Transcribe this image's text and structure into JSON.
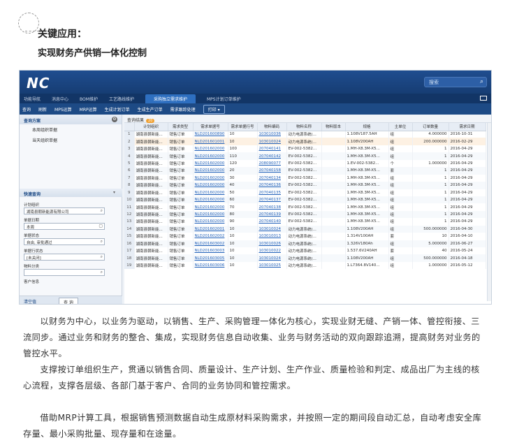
{
  "heading": {
    "line1": "关键应用：",
    "line2": "实现财务产供销一体化控制"
  },
  "app": {
    "logo": "NC",
    "search_placeholder": "搜索",
    "nav": [
      "功能导航",
      "消息中心",
      "BOM维护",
      "工艺路线维护",
      "采购独立需求维护",
      "MPS计划订单维护"
    ],
    "active_nav_index": 4,
    "toolbar": [
      "查询",
      "刷新",
      "MPS运算",
      "MRP运算",
      "生成计划订单",
      "生成生产订单",
      "需求跟踪处理",
      "打印 ▾"
    ],
    "left": {
      "plan_header": "查询方案",
      "plans": [
        "本周组织单据",
        "当天组织单据"
      ],
      "query_header": "快速查询",
      "fields": [
        {
          "label": "计划组织",
          "value": "湖南县朝新能源有限公司"
        },
        {
          "label": "单据日期",
          "value": "本周"
        },
        {
          "label": "单据状态",
          "value": "自由, 审批通过"
        },
        {
          "label": "单据行状态",
          "value": "[未关闭]"
        },
        {
          "label": "物料分类",
          "value": ""
        },
        {
          "label": "客户信息",
          "value": ""
        }
      ],
      "bottom_left": "清空值",
      "bottom_button": "查 询"
    },
    "results": {
      "title": "查询结果",
      "count": "20",
      "columns": [
        "",
        "计划组织",
        "需求类型",
        "需求单据号",
        "需求单据行号",
        "物料编码",
        "物料名称",
        "物料版本",
        "规格",
        "主单位",
        "订单数量",
        "需求日期"
      ],
      "rows": [
        [
          "1",
          "湖南县朝新能...",
          "销售订单",
          "NLD201600890",
          "10",
          "103010036",
          "动力电源系统(...",
          "",
          "1.108V187.5AH",
          "组",
          "4.000000",
          "2016-10-31"
        ],
        [
          "2",
          "湖南县朝新能...",
          "销售订单",
          "NLD201601001",
          "10",
          "103010024",
          "动力电源系统(...",
          "",
          "1.108V200AH",
          "组",
          "200.000000",
          "2016-02-29"
        ],
        [
          "3",
          "湖南县朝新能...",
          "销售订单",
          "NLD201602000",
          "100",
          "207040141",
          "EV-002-5382...",
          "",
          "1.MH-X8.3M-X5...",
          "组",
          "1",
          "2016-04-29"
        ],
        [
          "4",
          "湖南县朝新能...",
          "销售订单",
          "NLD201602000",
          "110",
          "207040142",
          "EV-002-5382...",
          "",
          "1.MH-X8.3M-X5...",
          "组",
          "1",
          "2016-04-29"
        ],
        [
          "5",
          "湖南县朝新能...",
          "销售订单",
          "NLD201602000",
          "120",
          "208090077",
          "EV-002-5382...",
          "",
          "1.EV-002-5382...",
          "个",
          "1.000000",
          "2016-04-29"
        ],
        [
          "6",
          "湖南县朝新能...",
          "销售订单",
          "NLD201602000",
          "20",
          "207040158",
          "EV-002-5382...",
          "",
          "1.MH-X8.3M-X5...",
          "套",
          "1",
          "2016-04-29"
        ],
        [
          "7",
          "湖南县朝新能...",
          "销售订单",
          "NLD201602000",
          "30",
          "207040134",
          "EV-002-5382...",
          "",
          "1.MH-X8.3M-X5...",
          "组",
          "1",
          "2016-04-29"
        ],
        [
          "8",
          "湖南县朝新能...",
          "销售订单",
          "NLD201602000",
          "40",
          "207040136",
          "EV-002-5382...",
          "",
          "1.MH-X8.3M-X5...",
          "组",
          "1",
          "2016-04-29"
        ],
        [
          "9",
          "湖南县朝新能...",
          "销售订单",
          "NLD201602000",
          "50",
          "207040135",
          "EV-002-5382...",
          "",
          "1.MH-X8.3M-X5...",
          "组",
          "1",
          "2016-04-29"
        ],
        [
          "10",
          "湖南县朝新能...",
          "销售订单",
          "NLD201602000",
          "60",
          "207040137",
          "EV-002-5382...",
          "",
          "1.MH-X8.3M-X5...",
          "组",
          "1",
          "2016-04-29"
        ],
        [
          "11",
          "湖南县朝新能...",
          "销售订单",
          "NLD201602000",
          "70",
          "207040138",
          "EV-002-5382...",
          "",
          "1.MH-X8.3M-X5...",
          "组",
          "1",
          "2016-04-29"
        ],
        [
          "12",
          "湖南县朝新能...",
          "销售订单",
          "NLD201602000",
          "80",
          "207040139",
          "EV-002-5382...",
          "",
          "1.MH-X8.3M-X5...",
          "组",
          "1",
          "2016-04-29"
        ],
        [
          "13",
          "湖南县朝新能...",
          "销售订单",
          "NLD201602000",
          "90",
          "207040140",
          "EV-002-5382...",
          "",
          "1.MH-X8.3M-X5...",
          "组",
          "1",
          "2016-04-29"
        ],
        [
          "14",
          "湖南县朝新能...",
          "销售订单",
          "NLD201602001",
          "10",
          "103010024",
          "动力电源系统(...",
          "",
          "1.108V200AH",
          "组",
          "500.000000",
          "2016-04-30"
        ],
        [
          "15",
          "湖南县朝新能...",
          "销售订单",
          "NLD201602002",
          "10",
          "103010013",
          "动力电源系统(...",
          "",
          "1.314V100AH",
          "套",
          "10",
          "2016-04-10"
        ],
        [
          "16",
          "湖南县朝新能...",
          "销售订单",
          "NLD201603002",
          "10",
          "103010026",
          "动力电源系统(...",
          "",
          "1.326V180Ah",
          "组",
          "5.000000",
          "2016-06-27"
        ],
        [
          "17",
          "湖南县朝新能...",
          "销售订单",
          "NLD201603003",
          "10",
          "103010022",
          "动力电源系统(...",
          "",
          "1.537.6V240AH",
          "套",
          "40",
          "2016-05-24"
        ],
        [
          "18",
          "湖南县朝新能...",
          "销售订单",
          "NLD201603005",
          "10",
          "103010024",
          "动力电源系统(...",
          "",
          "1.108V200AH",
          "组",
          "500.000000",
          "2016-04-18"
        ],
        [
          "19",
          "湖南县朝新能...",
          "销售订单",
          "NLD201603006",
          "10",
          "103010025",
          "动力电源系统(...",
          "",
          "1.L7364.8V140...",
          "组",
          "1.000000",
          "2016-05-12"
        ]
      ],
      "selected_row_index": 1
    }
  },
  "paragraphs": [
    "以财务为中心，以业务为驱动，以销售、生产、采购管理一体化为核心，实现业财无缝、产销一体、管控衔接、三流同步。通过业务和财务的整合、集成，实现财务信息自动收集、业务与财务活动的双向跟踪追溯，提高财务对业务的管控水平。",
    "支撑按订单组织生产，贯通以销售合同、质量设计、生产计划、生产作业、质量检验和判定、成品出厂为主线的核心流程，支撑各层级、各部门基于客户、合同的业务协同和管控需求。",
    "借助MRP计算工具，根据销售预测数据自动生成原材料采购需求，并按照一定的期间段自动汇总，自动考虑安全库存量、最小采购批量、现存量和在途量。"
  ]
}
